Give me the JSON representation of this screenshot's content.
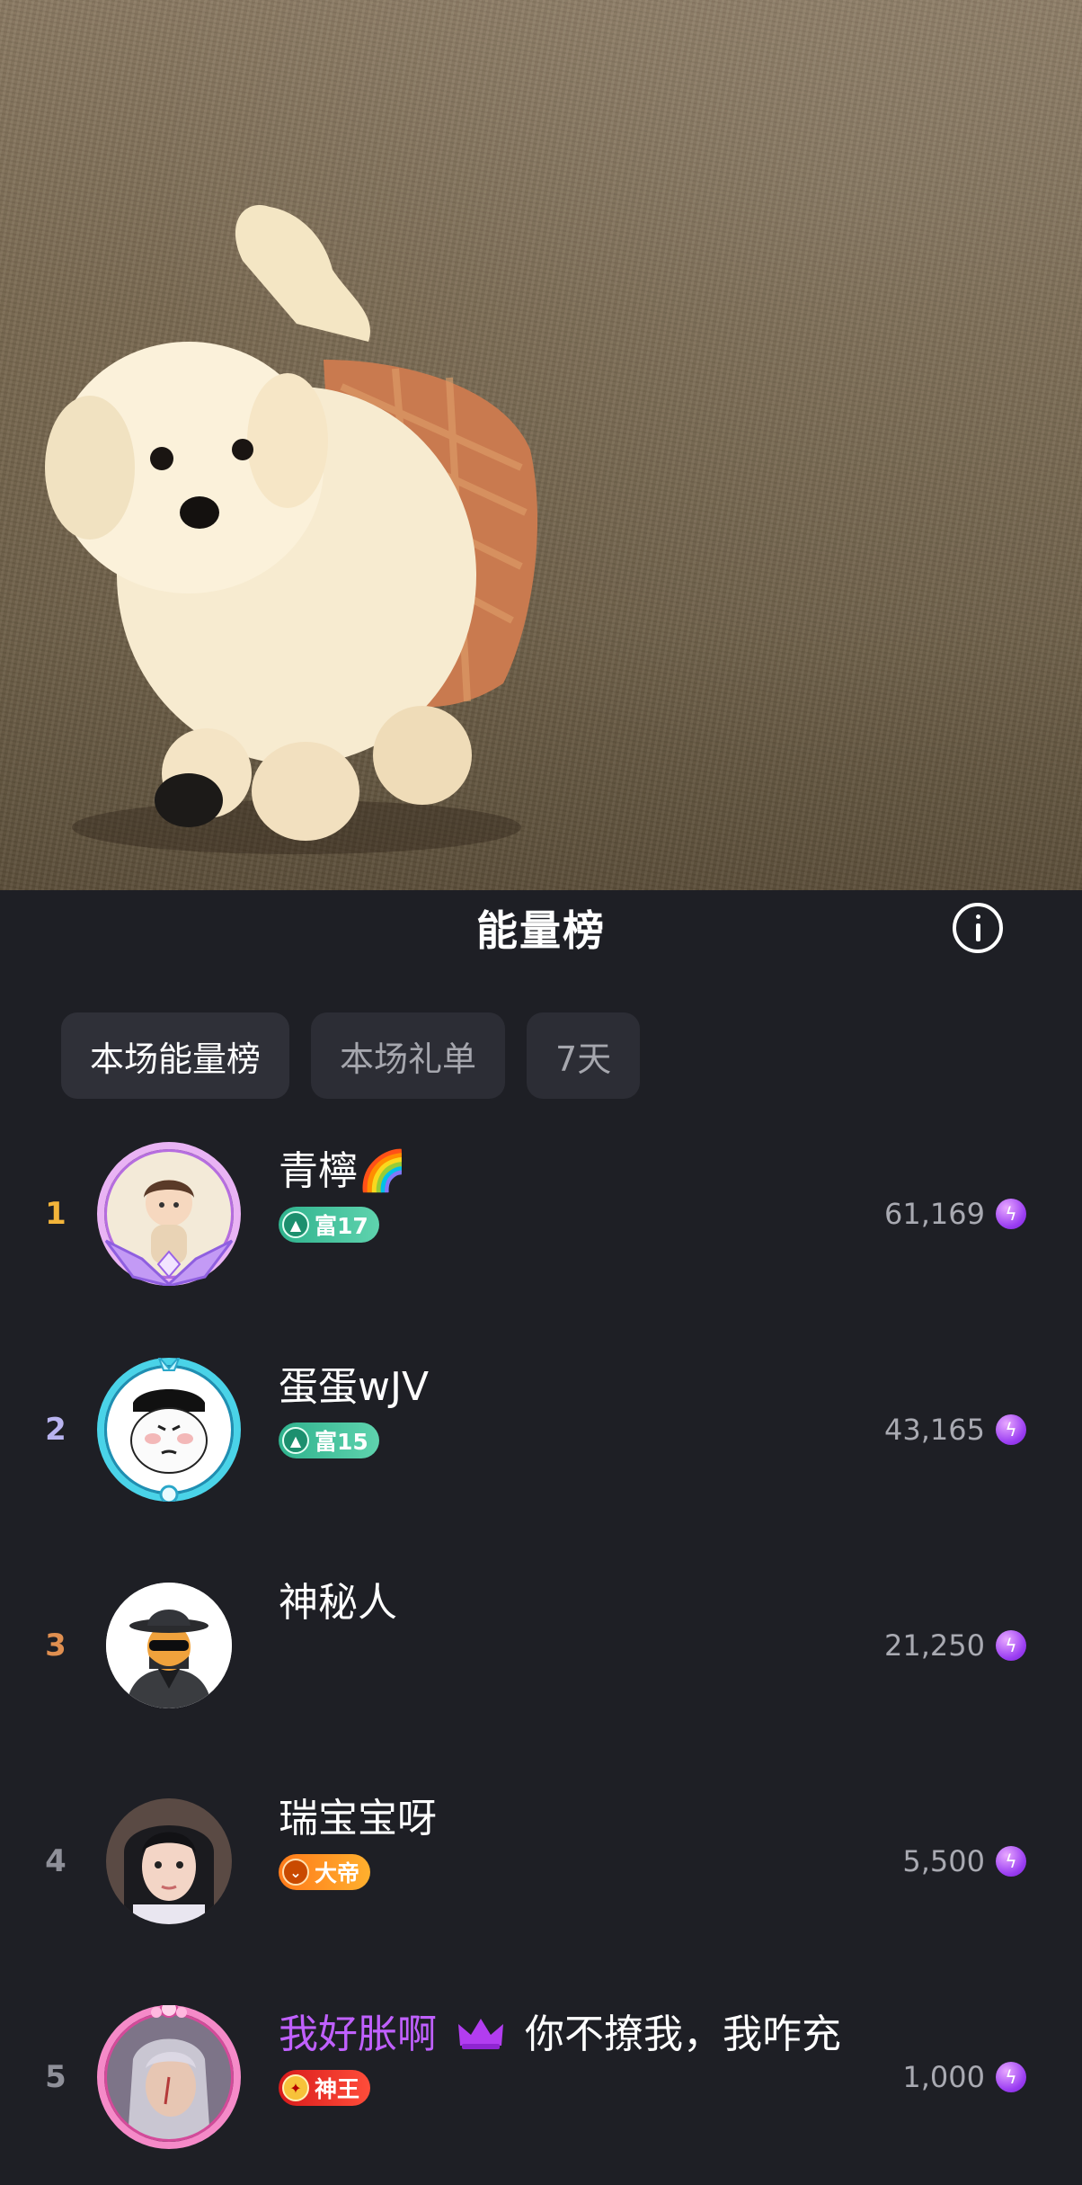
{
  "panel": {
    "title": "能量榜",
    "tabs": [
      {
        "label": "本场能量榜",
        "active": true
      },
      {
        "label": "本场礼单",
        "active": false
      },
      {
        "label": "7天",
        "active": false
      }
    ]
  },
  "rankings": [
    {
      "rank": "1",
      "name": "青檸🌈",
      "badge": {
        "type": "rich",
        "label": "富17"
      },
      "score": "61,169"
    },
    {
      "rank": "2",
      "name": "蛋蛋wJV",
      "badge": {
        "type": "rich",
        "label": "富15"
      },
      "score": "43,165"
    },
    {
      "rank": "3",
      "name": "神秘人",
      "badge": null,
      "score": "21,250"
    },
    {
      "rank": "4",
      "name": "瑞宝宝呀",
      "badge": {
        "type": "royal",
        "label": "大帝"
      },
      "score": "5,500"
    },
    {
      "rank": "5",
      "name": "我好胀啊",
      "name_extra": "你不撩我，我咋充",
      "badge": {
        "type": "god",
        "label": "神王"
      },
      "score": "1,000"
    }
  ],
  "colors": {
    "panel_bg": "#1e1f25",
    "tab_bg": "#2c2d35",
    "rank1": "#f3b43a",
    "rank2": "#b9b4f0",
    "rank3": "#e08f50",
    "energy": "#9b3ef2",
    "vip_name": "#c060ff"
  },
  "icons": {
    "info": "info-icon",
    "energy": "lightning-energy-icon",
    "crown": "crown-icon"
  }
}
